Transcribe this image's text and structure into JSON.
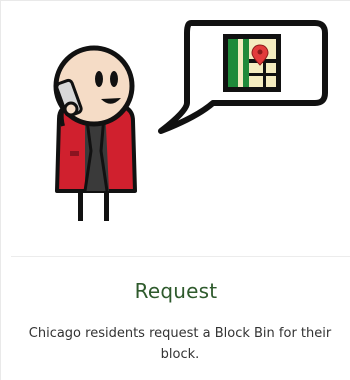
{
  "card": {
    "title": "Request",
    "description": "Chicago residents request a Block Bin for their block.",
    "title_color": "#2e5a2c"
  },
  "illustration": {
    "icons": [
      "person-on-phone-icon",
      "speech-bubble-icon",
      "map-pin-icon"
    ],
    "colors": {
      "jacket": "#d0202e",
      "skin": "#f5dcc6",
      "map_green": "#1f8a3a",
      "map_land": "#f4ecc0",
      "pin": "#e23b3b"
    }
  }
}
